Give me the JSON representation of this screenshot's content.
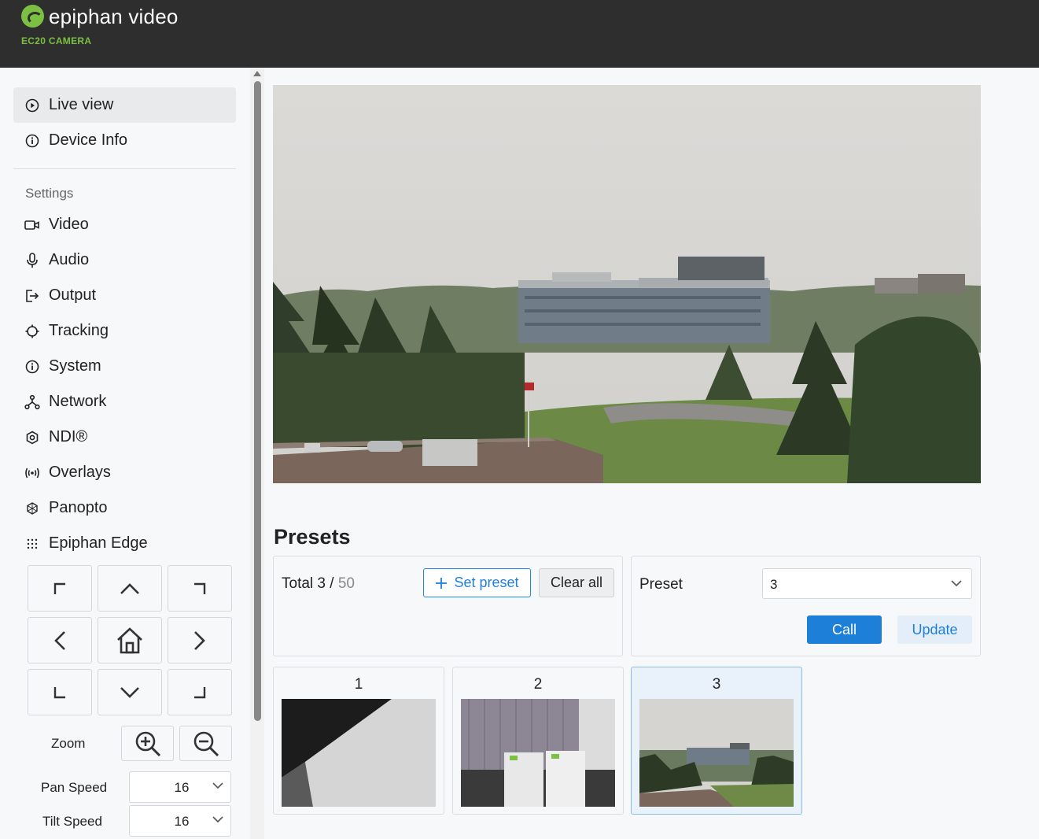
{
  "header": {
    "brand": "epiphan video",
    "product": "EC20 CAMERA"
  },
  "sidebar": {
    "items_top": [
      {
        "label": "Live view",
        "icon": "play-circle-icon",
        "active": true
      },
      {
        "label": "Device Info",
        "icon": "info-icon",
        "active": false
      }
    ],
    "settings_title": "Settings",
    "settings_items": [
      {
        "label": "Video",
        "icon": "video-camera-icon"
      },
      {
        "label": "Audio",
        "icon": "microphone-icon"
      },
      {
        "label": "Output",
        "icon": "output-icon"
      },
      {
        "label": "Tracking",
        "icon": "crosshair-icon"
      },
      {
        "label": "System",
        "icon": "info-icon"
      },
      {
        "label": "Network",
        "icon": "network-icon"
      },
      {
        "label": "NDI®",
        "icon": "ndi-icon"
      },
      {
        "label": "Overlays",
        "icon": "broadcast-icon"
      },
      {
        "label": "Panopto",
        "icon": "panopto-icon"
      },
      {
        "label": "Epiphan Edge",
        "icon": "grid-dots-icon"
      }
    ]
  },
  "ptz": {
    "zoom_label": "Zoom",
    "pan_speed_label": "Pan Speed",
    "pan_speed_value": "16",
    "tilt_speed_label": "Tilt Speed",
    "tilt_speed_value": "16"
  },
  "presets": {
    "title": "Presets",
    "total_label": "Total",
    "total_count": "3",
    "total_separator": "/",
    "total_max": "50",
    "set_preset_label": "Set preset",
    "clear_all_label": "Clear all",
    "preset_label": "Preset",
    "preset_selected": "3",
    "call_label": "Call",
    "update_label": "Update",
    "cards": [
      {
        "number": "1",
        "selected": false
      },
      {
        "number": "2",
        "selected": false
      },
      {
        "number": "3",
        "selected": true
      }
    ]
  },
  "colors": {
    "header_bg": "#2e2e2e",
    "brand_green": "#7bc043",
    "accent_blue": "#1e7fd9"
  }
}
